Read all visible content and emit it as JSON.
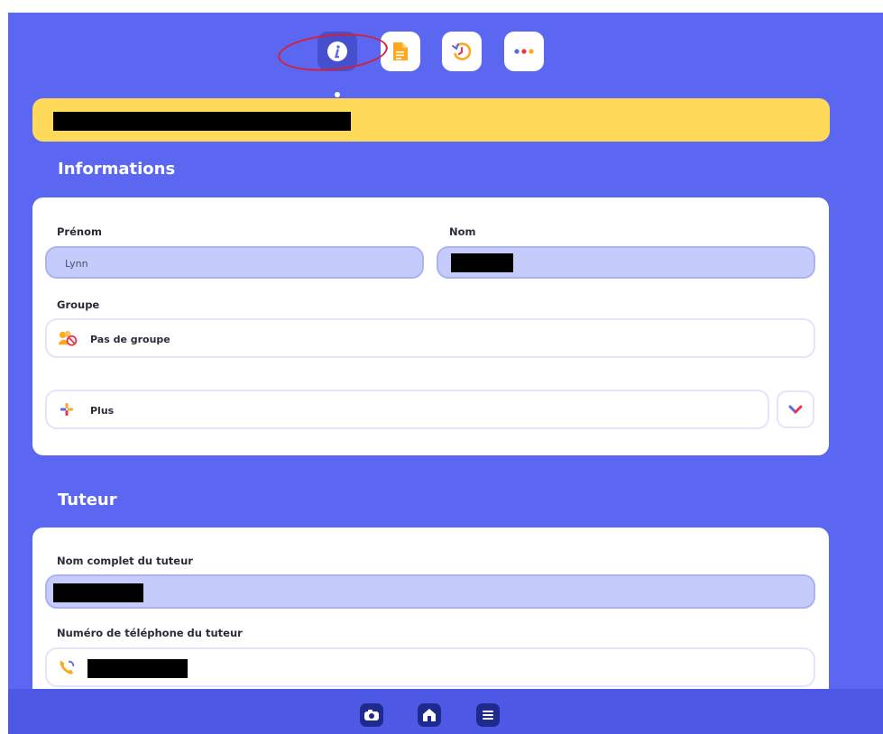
{
  "tabs": [
    {
      "id": "info",
      "icon": "info-icon",
      "active": true
    },
    {
      "id": "document",
      "icon": "document-icon",
      "active": false
    },
    {
      "id": "history",
      "icon": "history-icon",
      "active": false
    },
    {
      "id": "more",
      "icon": "more-dots-icon",
      "active": false
    }
  ],
  "sections": {
    "informations": {
      "title": "Informations",
      "prenom_label": "Prénom",
      "prenom_value": "Lynn",
      "nom_label": "Nom",
      "groupe_label": "Groupe",
      "groupe_value": "Pas de groupe",
      "plus_label": "Plus"
    },
    "tuteur": {
      "title": "Tuteur",
      "nom_complet_label": "Nom complet du tuteur",
      "telephone_label": "Numéro de téléphone du tuteur"
    }
  },
  "bottom_nav": [
    {
      "id": "camera",
      "icon": "camera-icon"
    },
    {
      "id": "home",
      "icon": "home-icon"
    },
    {
      "id": "menu",
      "icon": "menu-icon"
    }
  ],
  "colors": {
    "background": "#5b67f1",
    "banner": "#ffd95a",
    "field_filled": "#c5ccfb",
    "accent_red": "#e8354a"
  }
}
